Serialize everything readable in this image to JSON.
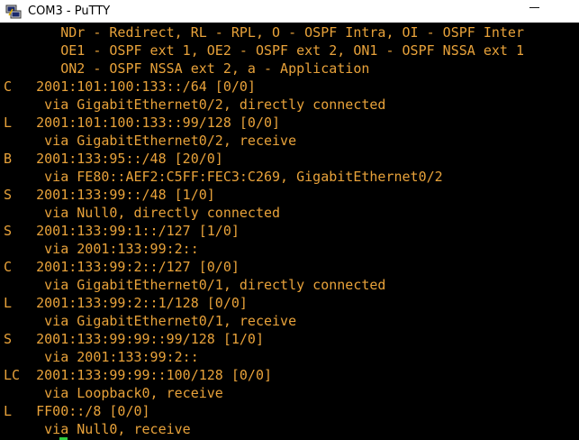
{
  "window": {
    "title": "COM3 - PuTTY",
    "app_icon": "putty-icon",
    "controls": [
      "minimize-icon"
    ]
  },
  "terminal": {
    "text_color": "#e8a23a",
    "background": "#000000",
    "cursor_color": "#2ecc40",
    "lines": [
      "       NDr - Redirect, RL - RPL, O - OSPF Intra, OI - OSPF Inter",
      "       OE1 - OSPF ext 1, OE2 - OSPF ext 2, ON1 - OSPF NSSA ext 1",
      "       ON2 - OSPF NSSA ext 2, a - Application",
      "C   2001:101:100:133::/64 [0/0]",
      "     via GigabitEthernet0/2, directly connected",
      "L   2001:101:100:133::99/128 [0/0]",
      "     via GigabitEthernet0/2, receive",
      "B   2001:133:95::/48 [20/0]",
      "     via FE80::AEF2:C5FF:FEC3:C269, GigabitEthernet0/2",
      "S   2001:133:99::/48 [1/0]",
      "     via Null0, directly connected",
      "S   2001:133:99:1::/127 [1/0]",
      "     via 2001:133:99:2::",
      "C   2001:133:99:2::/127 [0/0]",
      "     via GigabitEthernet0/1, directly connected",
      "L   2001:133:99:2::1/128 [0/0]",
      "     via GigabitEthernet0/1, receive",
      "S   2001:133:99:99::99/128 [1/0]",
      "     via 2001:133:99:2::",
      "LC  2001:133:99:99::100/128 [0/0]",
      "     via Loopback0, receive",
      "L   FF00::/8 [0/0]",
      "     via Null0, receive"
    ]
  }
}
